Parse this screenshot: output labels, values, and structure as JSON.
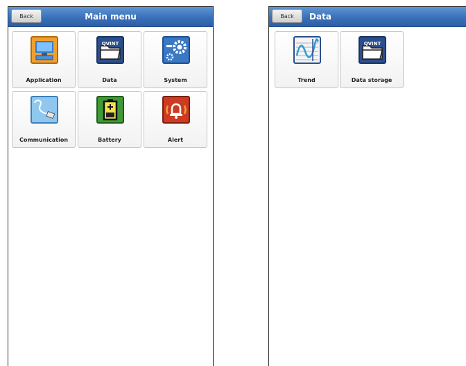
{
  "main_screen": {
    "back_label": "Back",
    "title": "Main menu",
    "tiles": [
      {
        "label": "Application",
        "icon": "application-icon"
      },
      {
        "label": "Data",
        "icon": "data-folder-icon"
      },
      {
        "label": "System",
        "icon": "system-gear-icon"
      },
      {
        "label": "Communication",
        "icon": "communication-cable-icon"
      },
      {
        "label": "Battery",
        "icon": "battery-icon"
      },
      {
        "label": "Alert",
        "icon": "alert-bell-icon"
      }
    ]
  },
  "data_screen": {
    "back_label": "Back",
    "title": "Data",
    "tiles": [
      {
        "label": "Trend",
        "icon": "trend-chart-icon"
      },
      {
        "label": "Data storage",
        "icon": "data-storage-folder-icon"
      }
    ]
  },
  "icon_text": {
    "folder_logo": "QVINT"
  },
  "colors": {
    "titlebar": "#3a70b8",
    "application_icon": "#f0a030",
    "data_icon": "#2b4f8e",
    "system_icon": "#3b78c4",
    "communication_icon": "#8fc7ee",
    "battery_icon": "#3f9a36",
    "alert_icon": "#cc3b22"
  }
}
